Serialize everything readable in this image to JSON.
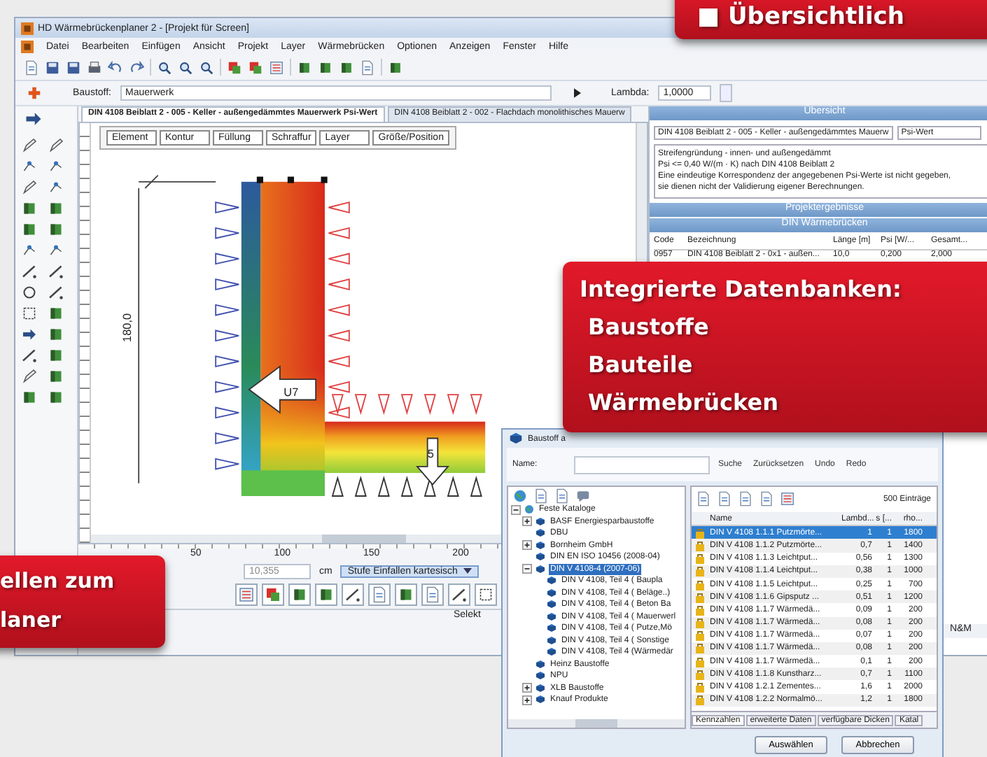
{
  "app": {
    "title": "HD Wärmebrückenplaner 2 - [Projekt für Screen]",
    "menu": [
      "Datei",
      "Bearbeiten",
      "Einfügen",
      "Ansicht",
      "Projekt",
      "Layer",
      "Wärmebrücken",
      "Optionen",
      "Anzeigen",
      "Fenster",
      "Hilfe"
    ]
  },
  "properties": {
    "material_label": "Baustoff:",
    "material": "Mauerwerk",
    "lambda_label": "Lambda:",
    "lambda": "1,0000"
  },
  "doc_tabs": [
    {
      "label": "DIN 4108 Beiblatt 2 - 005 - Keller - außengedämmtes Mauerwerk Psi-Wert",
      "selected": true
    },
    {
      "label": "DIN 4108 Beiblatt 2 - 002 - Flachdach monolithisches Mauerw",
      "selected": false
    }
  ],
  "column_tabs": [
    "Element",
    "Kontur",
    "Füllung",
    "Schraffur",
    "Layer",
    "Größe/Position"
  ],
  "drawing": {
    "dimension": "180,0",
    "marker": "U7",
    "slab_marker": "5"
  },
  "ruler": [
    "50",
    "100",
    "150",
    "200"
  ],
  "zoom": {
    "value": "10,355",
    "unit": "cm",
    "mode": "Stufe Einfallen kartesisch"
  },
  "status": "Selekt",
  "overview": {
    "title": "Übersicht",
    "selection": "DIN 4108 Beiblatt 2 - 005 - Keller - außengedämmtes Mauerw",
    "mode": "Psi-Wert",
    "description": [
      "Streifengründung - innen- und außengedämmt",
      "Psi <= 0,40 W/(m · K) nach DIN 4108 Beiblatt 2",
      "Eine eindeutige Korrespondenz der angegebenen Psi-Werte ist nicht gegeben,",
      "sie dienen nicht der Validierung eigener Berechnungen."
    ],
    "results_title": "Projektergebnisse",
    "bridges_title": "DIN Wärmebrücken",
    "columns": [
      "Code",
      "Bezeichnung",
      "Länge [m]",
      "Psi [W/...",
      "Gesamt..."
    ],
    "rows": [
      [
        "0957",
        "DIN 4108 Beiblatt 2 - 0x1 - außen...",
        "10,0",
        "0,200",
        "2,000"
      ]
    ],
    "footer": "N&M"
  },
  "dialog": {
    "title": "Baustoff a",
    "name_label": "Name:",
    "actions": [
      "Suche",
      "Zurücksetzen",
      "Undo",
      "Redo"
    ],
    "tree": [
      {
        "label": "Feste Kataloge",
        "expanded": true,
        "selected": false,
        "children": [
          {
            "label": "BASF Energiesparbaustoffe",
            "expanded": false,
            "selected": false
          },
          {
            "label": "DBU",
            "selected": false
          },
          {
            "label": "Bornheim GmbH",
            "expanded": false,
            "selected": false
          },
          {
            "label": "DIN EN ISO 10456 (2008-04)",
            "selected": false
          },
          {
            "label": "DIN V 4108-4 (2007-06)",
            "expanded": true,
            "selected": true,
            "children": [
              {
                "label": "DIN V 4108, Teil 4 ( Baupla",
                "selected": false
              },
              {
                "label": "DIN V 4108, Teil 4 ( Beläge..)",
                "selected": false
              },
              {
                "label": "DIN V 4108, Teil 4 ( Beton Ba",
                "selected": false
              },
              {
                "label": "DIN V 4108, Teil 4 ( Mauerwerl",
                "selected": false
              },
              {
                "label": "DIN V 4108, Teil 4 ( Putze,Mö",
                "selected": false
              },
              {
                "label": "DIN V 4108, Teil 4 ( Sonstige",
                "selected": false
              },
              {
                "label": "DIN V 4108, Teil 4 (Wärmedär",
                "selected": false
              }
            ]
          },
          {
            "label": "Heinz Baustoffe",
            "selected": false
          },
          {
            "label": "NPU",
            "selected": false
          },
          {
            "label": "XLB Baustoffe",
            "expanded": false,
            "selected": false
          },
          {
            "label": "Knauf Produkte",
            "expanded": false,
            "selected": false
          }
        ]
      }
    ],
    "count": "500 Einträge",
    "columns": [
      "Name",
      "Lambd...",
      "s [...",
      "rho..."
    ],
    "rows": [
      {
        "cells": [
          "DIN V 4108 1.1.1 Putzmörte...",
          "1",
          "1",
          "1800"
        ],
        "selected": true
      },
      {
        "cells": [
          "DIN V 4108 1.1.2 Putzmörte...",
          "0,7",
          "1",
          "1400"
        ],
        "selected": false
      },
      {
        "cells": [
          "DIN V 4108 1.1.3 Leichtput...",
          "0,56",
          "1",
          "1300"
        ],
        "selected": false
      },
      {
        "cells": [
          "DIN V 4108 1.1.4 Leichtput...",
          "0,38",
          "1",
          "1000"
        ],
        "selected": false
      },
      {
        "cells": [
          "DIN V 4108 1.1.5 Leichtput...",
          "0,25",
          "1",
          "700"
        ],
        "selected": false
      },
      {
        "cells": [
          "DIN V 4108 1.1.6 Gipsputz ...",
          "0,51",
          "1",
          "1200"
        ],
        "selected": false
      },
      {
        "cells": [
          "DIN V 4108 1.1.7 Wärmedä...",
          "0,09",
          "1",
          "200"
        ],
        "selected": false
      },
      {
        "cells": [
          "DIN V 4108 1.1.7 Wärmedä...",
          "0,08",
          "1",
          "200"
        ],
        "selected": false
      },
      {
        "cells": [
          "DIN V 4108 1.1.7 Wärmedä...",
          "0,07",
          "1",
          "200"
        ],
        "selected": false
      },
      {
        "cells": [
          "DIN V 4108 1.1.7 Wärmedä...",
          "0,08",
          "1",
          "200"
        ],
        "selected": false
      },
      {
        "cells": [
          "DIN V 4108 1.1.7 Wärmedä...",
          "0,1",
          "1",
          "200"
        ],
        "selected": false
      },
      {
        "cells": [
          "DIN V 4108 1.1.8 Kunstharz...",
          "0,7",
          "1",
          "1100"
        ],
        "selected": false
      },
      {
        "cells": [
          "DIN V 4108 1.2.1 Zementes...",
          "1,6",
          "1",
          "2000"
        ],
        "selected": false
      },
      {
        "cells": [
          "DIN V 4108 1.2.2 Normalmö...",
          "1,2",
          "1",
          "1800"
        ],
        "selected": false
      }
    ],
    "tabs": [
      {
        "label": "Kennzahlen",
        "selected": true
      },
      {
        "label": "erweiterte Daten",
        "selected": false
      },
      {
        "label": "verfügbare Dicken",
        "selected": false
      },
      {
        "label": "Katal",
        "selected": false
      }
    ],
    "buttons": [
      "Auswählen",
      "Abbrechen"
    ]
  },
  "banners": [
    {
      "kind": "top",
      "lines": [
        "■ Übersichtlich"
      ]
    },
    {
      "kind": "middle",
      "lines": [
        "Integrierte Datenbanken:",
        "Baustoffe",
        "Bauteile",
        "Wärmebrücken"
      ]
    },
    {
      "kind": "left",
      "lines": [
        "ellen zum",
        "laner"
      ]
    }
  ]
}
